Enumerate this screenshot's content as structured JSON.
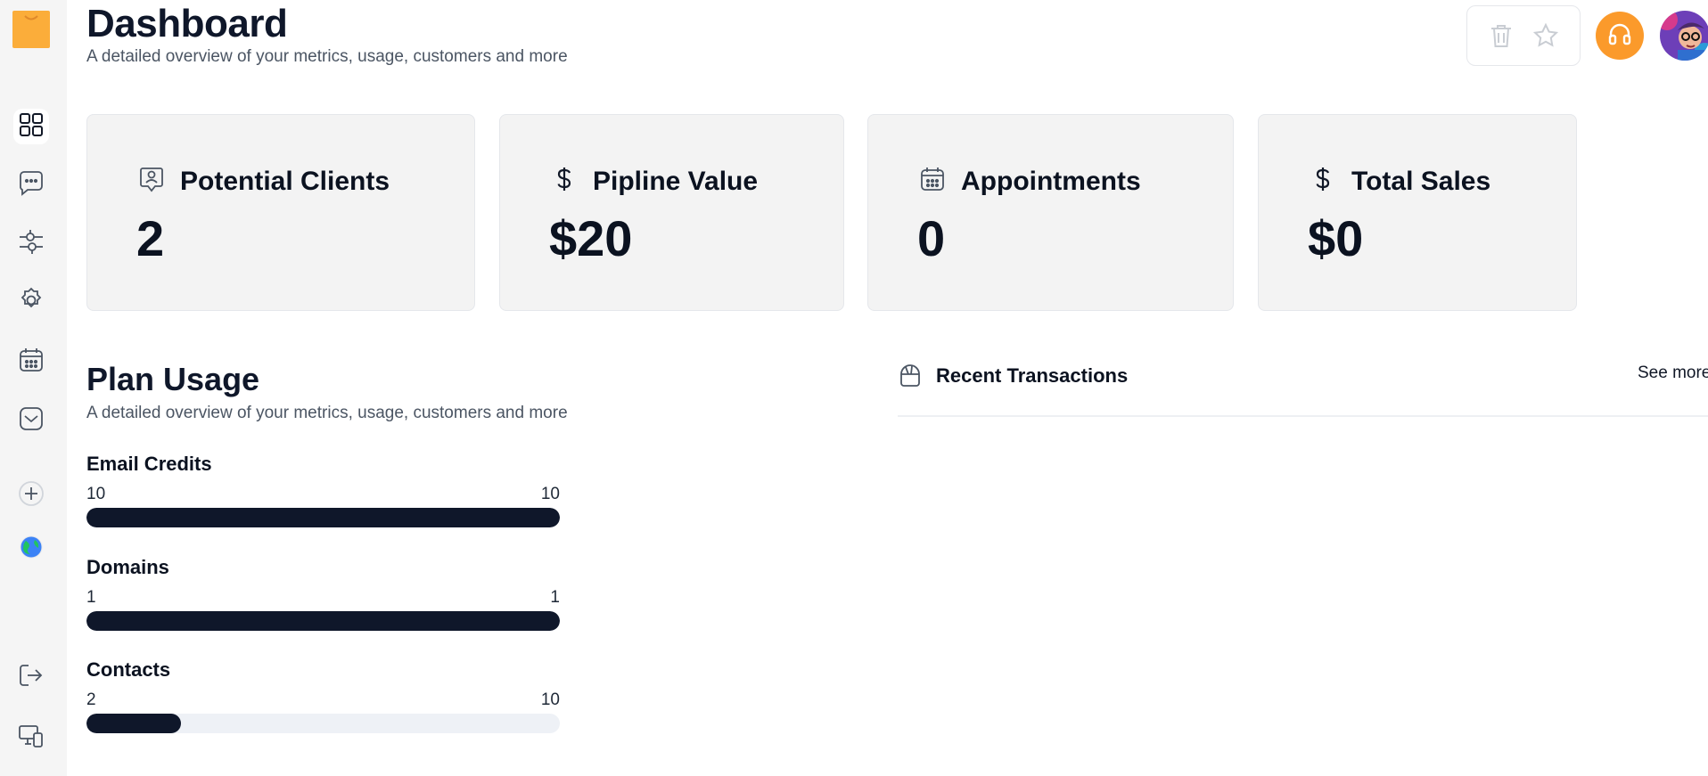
{
  "header": {
    "title": "Dashboard",
    "subtitle": "A detailed overview of your metrics, usage, customers and more"
  },
  "sidebar": {
    "items": [
      {
        "name": "dashboard",
        "icon": "grid-icon",
        "active": true
      },
      {
        "name": "messages",
        "icon": "chat-icon"
      },
      {
        "name": "filters",
        "icon": "sliders-icon"
      },
      {
        "name": "settings",
        "icon": "gear-icon"
      },
      {
        "name": "calendar",
        "icon": "calendar-icon"
      },
      {
        "name": "inbox",
        "icon": "inbox-icon"
      },
      {
        "name": "add",
        "icon": "plus-icon"
      },
      {
        "name": "globe",
        "icon": "globe-icon"
      },
      {
        "name": "logout",
        "icon": "logout-icon"
      },
      {
        "name": "devices",
        "icon": "devices-icon"
      }
    ]
  },
  "toolbar": {
    "icons": [
      "trash-icon",
      "star-icon",
      "headphones-icon",
      "avatar"
    ]
  },
  "stats": [
    {
      "label": "Potential Clients",
      "value": "2",
      "icon": "person-badge-icon"
    },
    {
      "label": "Pipline Value",
      "value": "$20",
      "icon": "dollar-icon"
    },
    {
      "label": "Appointments",
      "value": "0",
      "icon": "calendar-icon"
    },
    {
      "label": "Total Sales",
      "value": "$0",
      "icon": "dollar-icon"
    }
  ],
  "plan_usage": {
    "title": "Plan Usage",
    "subtitle": "A detailed overview of your metrics, usage, customers and more",
    "items": [
      {
        "label": "Email Credits",
        "used": "10",
        "total": "10",
        "fraction": 1.0
      },
      {
        "label": "Domains",
        "used": "1",
        "total": "1",
        "fraction": 1.0
      },
      {
        "label": "Contacts",
        "used": "2",
        "total": "10",
        "fraction": 0.2
      }
    ]
  },
  "recent_transactions": {
    "title": "Recent Transactions",
    "see_more": "See more"
  },
  "colors": {
    "accent": "#fb9a2b",
    "logo": "#fbad3a",
    "bar_fill": "#0f172a",
    "bar_track": "#eef1f6",
    "card_bg": "#f3f3f3"
  }
}
